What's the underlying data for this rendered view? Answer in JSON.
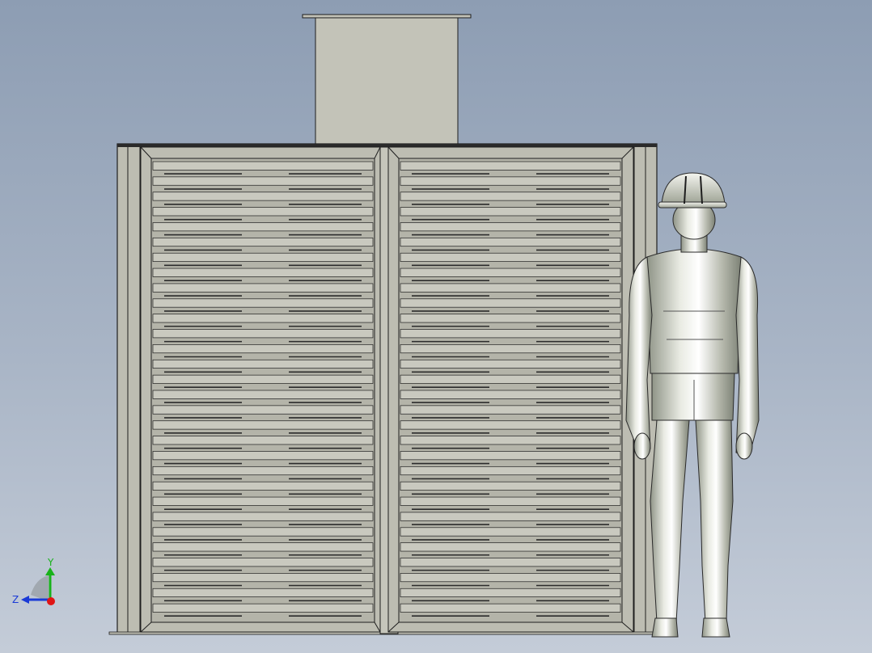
{
  "viewport": {
    "background_top": "#8d9db3",
    "background_bottom": "#c4ccd8"
  },
  "model": {
    "duct_color": "#c3c3b8",
    "frame_color": "#bdbdb2",
    "louver_color": "#c9c9bf",
    "outline_color": "#1e1e1e",
    "louver_count": 30
  },
  "mannequin": {
    "body_color": "#bfc3b6",
    "highlight_color": "#f2f3ee"
  },
  "triad": {
    "y_label": "Y",
    "z_label": "Z",
    "y_color": "#18b21a",
    "z_color": "#1a3ad6",
    "x_color": "#e01414"
  }
}
